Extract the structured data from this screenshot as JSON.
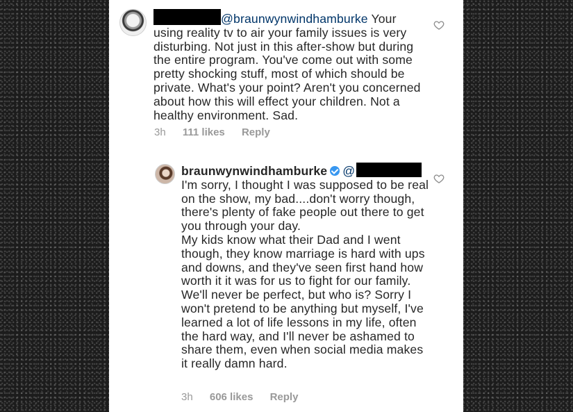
{
  "comment": {
    "mention": "@braunwynwindhamburke",
    "text_first": " Your",
    "text_rest": "using reality tv to air your family issues is very disturbing. Not just in this after-show but during the entire program. You've come out with some pretty shocking stuff, most of which should be private. What's your point?  Aren't you concerned about how this will effect your children. Not a healthy environment. Sad.",
    "time": "3h",
    "likes": "111 likes",
    "reply_label": "Reply"
  },
  "reply": {
    "username": "braunwynwindhamburke",
    "mention_prefix": "@",
    "paragraph_1": "I'm sorry, I thought I was supposed to be real on the show, my bad....don't worry though, there's plenty of fake people out there to get you through your day.",
    "paragraph_2": "My kids know what their Dad and I went though, they know marriage is hard with ups and downs, and they've seen first hand how worth it it was for us to fight for our family.  We'll never be perfect, but who is? Sorry I won't pretend to be anything but myself, I've learned a lot of life lessons in my life, often the hard way, and I'll never be ashamed to share them, even when social media makes it really damn hard.",
    "time": "3h",
    "likes": "606 likes",
    "reply_label": "Reply"
  },
  "icons": {
    "heart": "heart-outline-icon",
    "verified": "verified-badge-icon"
  },
  "colors": {
    "text": "#262626",
    "mention": "#003569",
    "meta": "#999999",
    "verified": "#3897f0",
    "redaction": "#000000"
  }
}
